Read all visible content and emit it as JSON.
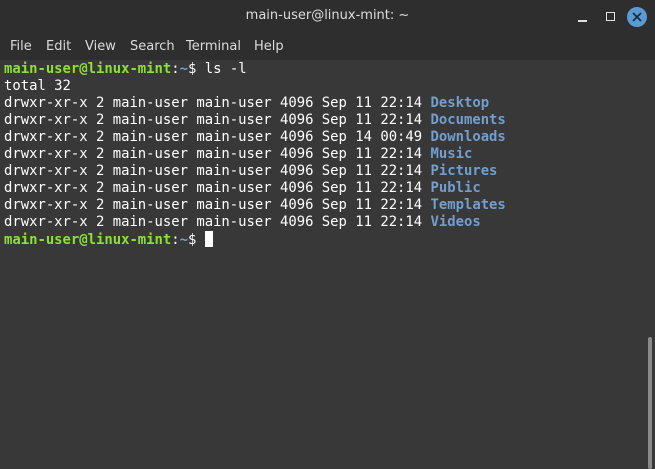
{
  "window": {
    "title": "main-user@linux-mint: ~"
  },
  "menu": {
    "file": "File",
    "edit": "Edit",
    "view": "View",
    "search": "Search",
    "terminal": "Terminal",
    "help": "Help"
  },
  "terminal": {
    "prompt_user": "main-user@linux-mint",
    "prompt_sep": ":",
    "prompt_path": "~",
    "prompt_symbol": "$",
    "command": " ls -l",
    "total": "total 32",
    "entries": [
      {
        "meta": "drwxr-xr-x 2 main-user main-user 4096 Sep 11 22:14 ",
        "name": "Desktop"
      },
      {
        "meta": "drwxr-xr-x 2 main-user main-user 4096 Sep 11 22:14 ",
        "name": "Documents"
      },
      {
        "meta": "drwxr-xr-x 2 main-user main-user 4096 Sep 14 00:49 ",
        "name": "Downloads"
      },
      {
        "meta": "drwxr-xr-x 2 main-user main-user 4096 Sep 11 22:14 ",
        "name": "Music"
      },
      {
        "meta": "drwxr-xr-x 2 main-user main-user 4096 Sep 11 22:14 ",
        "name": "Pictures"
      },
      {
        "meta": "drwxr-xr-x 2 main-user main-user 4096 Sep 11 22:14 ",
        "name": "Public"
      },
      {
        "meta": "drwxr-xr-x 2 main-user main-user 4096 Sep 11 22:14 ",
        "name": "Templates"
      },
      {
        "meta": "drwxr-xr-x 2 main-user main-user 4096 Sep 11 22:14 ",
        "name": "Videos"
      }
    ]
  },
  "colors": {
    "prompt_user": "#8ae234",
    "directory": "#729fcf",
    "close_button": "#5b9bd5"
  }
}
